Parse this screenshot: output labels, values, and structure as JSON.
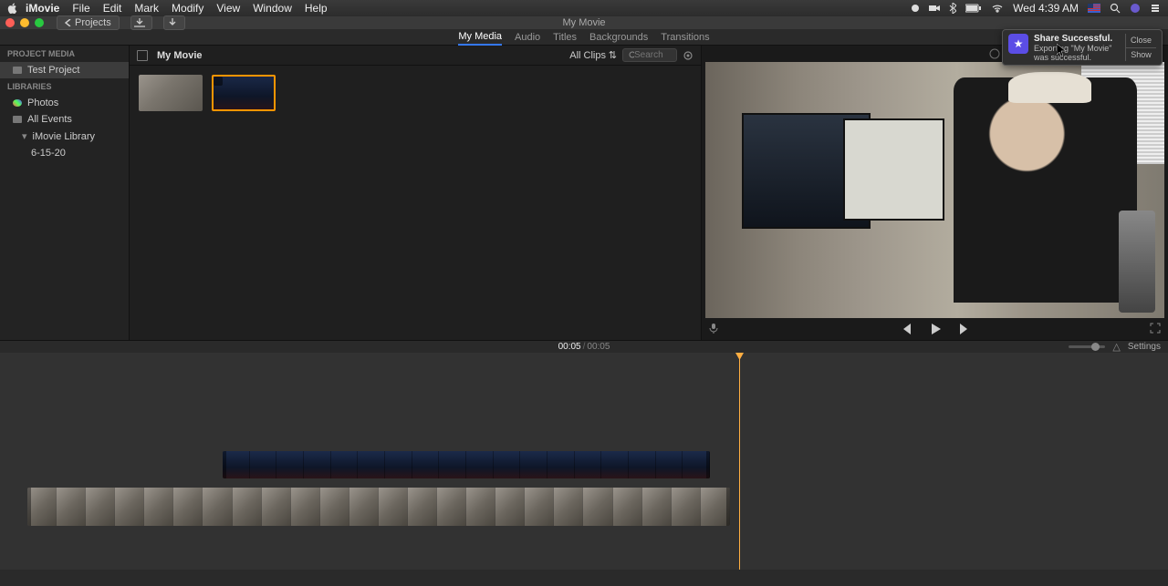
{
  "menubar": {
    "app": "iMovie",
    "items": [
      "File",
      "Edit",
      "Mark",
      "Modify",
      "View",
      "Window",
      "Help"
    ],
    "clock": "Wed 4:39 AM"
  },
  "window": {
    "title": "My Movie",
    "back_label": "Projects"
  },
  "tabs": [
    "My Media",
    "Audio",
    "Titles",
    "Backgrounds",
    "Transitions"
  ],
  "tabs_active_index": 0,
  "sidebar": {
    "section_project": "PROJECT MEDIA",
    "project_name": "Test Project",
    "section_libraries": "LIBRARIES",
    "items": [
      {
        "label": "Photos"
      },
      {
        "label": "All Events"
      },
      {
        "label": "iMovie Library"
      },
      {
        "label": "6-15-20"
      }
    ]
  },
  "browser": {
    "title": "My Movie",
    "filter": "All Clips",
    "search_placeholder": "Search"
  },
  "preview": {
    "current_time": "00:05",
    "duration": "00:05",
    "settings_label": "Settings"
  },
  "notification": {
    "title": "Share Successful.",
    "message": "Exporting \"My Movie\" was successful.",
    "close": "Close",
    "show": "Show"
  }
}
